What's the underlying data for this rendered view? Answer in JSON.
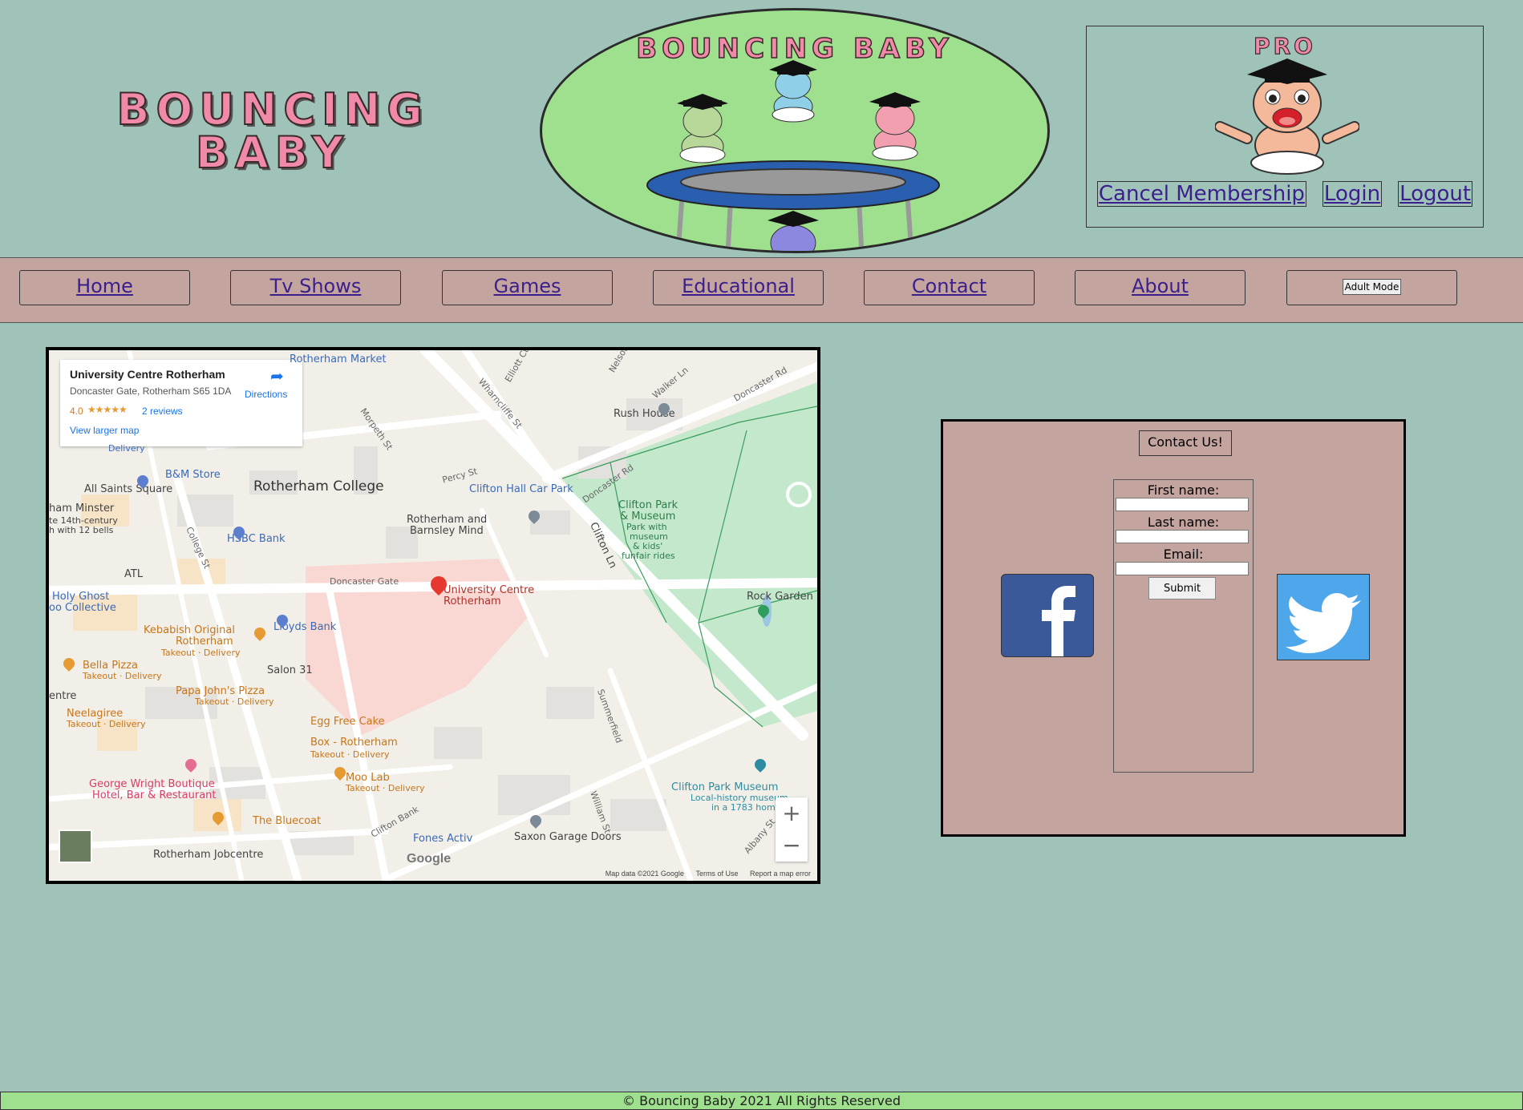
{
  "header": {
    "logo_line1": "BOUNCING",
    "logo_line2": "BABY",
    "banner_title": "BOUNCING BABY",
    "pro_label": "PRO"
  },
  "account": {
    "cancel_label": "Cancel Membership",
    "login_label": "Login",
    "logout_label": "Logout"
  },
  "nav": {
    "items": [
      {
        "label": "Home"
      },
      {
        "label": "Tv Shows"
      },
      {
        "label": "Games"
      },
      {
        "label": "Educational"
      },
      {
        "label": "Contact"
      },
      {
        "label": "About"
      }
    ],
    "adult_mode_label": "Adult Mode"
  },
  "map": {
    "place_name": "University Centre Rotherham",
    "address": "Doncaster Gate, Rotherham S65 1DA",
    "rating": "4.0",
    "stars": "★★★★★",
    "reviews": "2 reviews",
    "larger_map": "View larger map",
    "directions": "Directions",
    "zoom_in": "+",
    "zoom_out": "−",
    "google": "Google",
    "footer_data": "Map data ©2021 Google",
    "footer_terms": "Terms of Use",
    "footer_report": "Report a map error",
    "labels": {
      "rotherham_market": "Rotherham Market",
      "rotherham_college": "Rotherham College",
      "bm_store": "B&M Store",
      "hsbc": "HSBC Bank",
      "atl": "ATL",
      "holy_ghost": "Holy Ghost",
      "poo_collective": "oo Collective",
      "minster": "ham Minster",
      "minster_sub": "te 14th-century",
      "minster_sub2": "h with 12 bells",
      "kebabish": "Kebabish Original",
      "kebabish2": "Rotherham",
      "takeout_delivery": "Takeout · Delivery",
      "lloyds": "Lloyds Bank",
      "bella": "Bella Pizza",
      "salon": "Salon 31",
      "papa": "Papa John's Pizza",
      "neelagiree": "Neelagiree",
      "egg_free": "Egg Free Cake",
      "egg_free2": "Box - Rotherham",
      "moo_lab": "Moo Lab",
      "george": "George Wright Boutique",
      "george2": "Hotel, Bar & Restaurant",
      "bluecoat": "The Bluecoat",
      "jobcentre": "Rotherham Jobcentre",
      "fones": "Fones Activ",
      "saxon": "Saxon Garage Doors",
      "uni_pin": "University Centre",
      "uni_pin2": "Rotherham",
      "rotherham_barnsley": "Rotherham and",
      "rotherham_barnsley2": "Barnsley Mind",
      "clifton_car": "Clifton Hall Car Park",
      "rush_house": "Rush House",
      "clifton_park": "Clifton Park",
      "clifton_park2": "& Museum",
      "clifton_park3": "Park with",
      "clifton_park4": "museum",
      "clifton_park5": "& kids'",
      "clifton_park6": "funfair rides",
      "rock_garden": "Rock Garden",
      "clifton_museum": "Clifton Park Museum",
      "clifton_museum2": "Local-history museum",
      "clifton_museum3": "in a 1783 home",
      "all_saints": "All Saints Square",
      "delivery": "Delivery",
      "entre": "entre",
      "st_wharncliffe": "Wharncliffe St",
      "st_morpeth": "Morpeth St",
      "st_percy": "Percy St",
      "st_college": "College St",
      "st_doncaster_gate": "Doncaster Gate",
      "st_doncaster_rd": "Doncaster Rd",
      "st_clifton": "Clifton Ln",
      "st_walker": "Walker Ln",
      "st_summerfield": "Summerfield",
      "st_clifton_bank": "Clifton Bank",
      "st_william": "William St",
      "st_albany": "Albany St",
      "st_elliot": "Elliott Ct",
      "st_nelson": "Nelson"
    }
  },
  "contact": {
    "title": "Contact Us!",
    "first_name_label": "First name:",
    "last_name_label": "Last name:",
    "email_label": "Email:",
    "submit_label": "Submit"
  },
  "footer": {
    "text": "© Bouncing Baby 2021 All Rights Reserved"
  },
  "colors": {
    "page_bg": "#9fc3b9",
    "nav_bg": "#c4a49e",
    "banner_bg": "#9fe08f",
    "link": "#3b1f8c",
    "logo_pink": "#f08aa8",
    "facebook": "#3b5998",
    "twitter": "#4da7ea"
  }
}
